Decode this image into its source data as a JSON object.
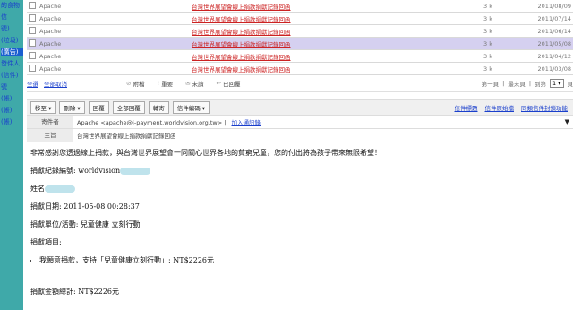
{
  "sidebar": {
    "labels": [
      "的食物",
      "信",
      "號)",
      "(垃圾)",
      "(廣告)",
      "發件人",
      "(信件)",
      "號",
      "(帳)",
      "(帳)",
      "(帳)"
    ]
  },
  "messages": [
    {
      "sender": "Apache",
      "subject": "台灣世界展望會線上捐款捐獻記錄回函",
      "size": "3 k",
      "date": "2011/08/09",
      "selected": false
    },
    {
      "sender": "Apache",
      "subject": "台灣世界展望會線上捐款捐獻記錄回函",
      "size": "3 k",
      "date": "2011/07/14",
      "selected": false
    },
    {
      "sender": "Apache",
      "subject": "台灣世界展望會線上捐款捐獻記錄回函",
      "size": "3 k",
      "date": "2011/06/14",
      "selected": false
    },
    {
      "sender": "Apache",
      "subject": "台灣世界展望會線上捐款捐獻記錄回函",
      "size": "3 k",
      "date": "2011/05/08",
      "selected": true
    },
    {
      "sender": "Apache",
      "subject": "台灣世界展望會線上捐款捐獻記錄回函",
      "size": "3 k",
      "date": "2011/04/12",
      "selected": false
    },
    {
      "sender": "Apache",
      "subject": "台灣世界展望會線上捐款捐獻記錄回函",
      "size": "3 k",
      "date": "2011/03/08",
      "selected": false
    }
  ],
  "actions": {
    "select_all": "全選",
    "unselect_all": "全部取消",
    "attachment": "附檔",
    "important": "重要",
    "unread": "未讀",
    "replied": "已回覆"
  },
  "pager": {
    "first": "第一頁",
    "last": "最末頁",
    "goto": "到第",
    "page": "1",
    "unit": "頁"
  },
  "toolbar": {
    "buttons": [
      "移至",
      "刪除",
      "回覆",
      "全部回覆",
      "轉寄",
      "信件編碼"
    ],
    "right_links": [
      "信件標題",
      "信件原始檔",
      "同類信件封鎖功能"
    ]
  },
  "header": {
    "from_label": "寄件者",
    "from_value": "Apache <apache@i-payment.worldvision.org.tw>",
    "add_contact": "加入通訊錄",
    "subject_label": "主旨",
    "subject_value": "台灣世界展望會線上捐款捐獻記錄回函"
  },
  "body": {
    "intro": "非常感謝您透過線上捐款，與台灣世界展望會一同關心世界各地的貧窮兒童，您的付出將為孩子帶來無限希望！",
    "donor_id_label": "捐獻紀錄編號: worldvision",
    "name_label": "姓名",
    "date_line": "捐獻日期: 2011-05-08 00:28:37",
    "unit_line": "捐獻單位/活動: 兒童健康 立刻行動",
    "items_label": "捐獻項目:",
    "item": "我願意捐款，支持「兒童健康立刻行動」: NT$2226元",
    "total": "捐獻金額總計: NT$2226元"
  }
}
